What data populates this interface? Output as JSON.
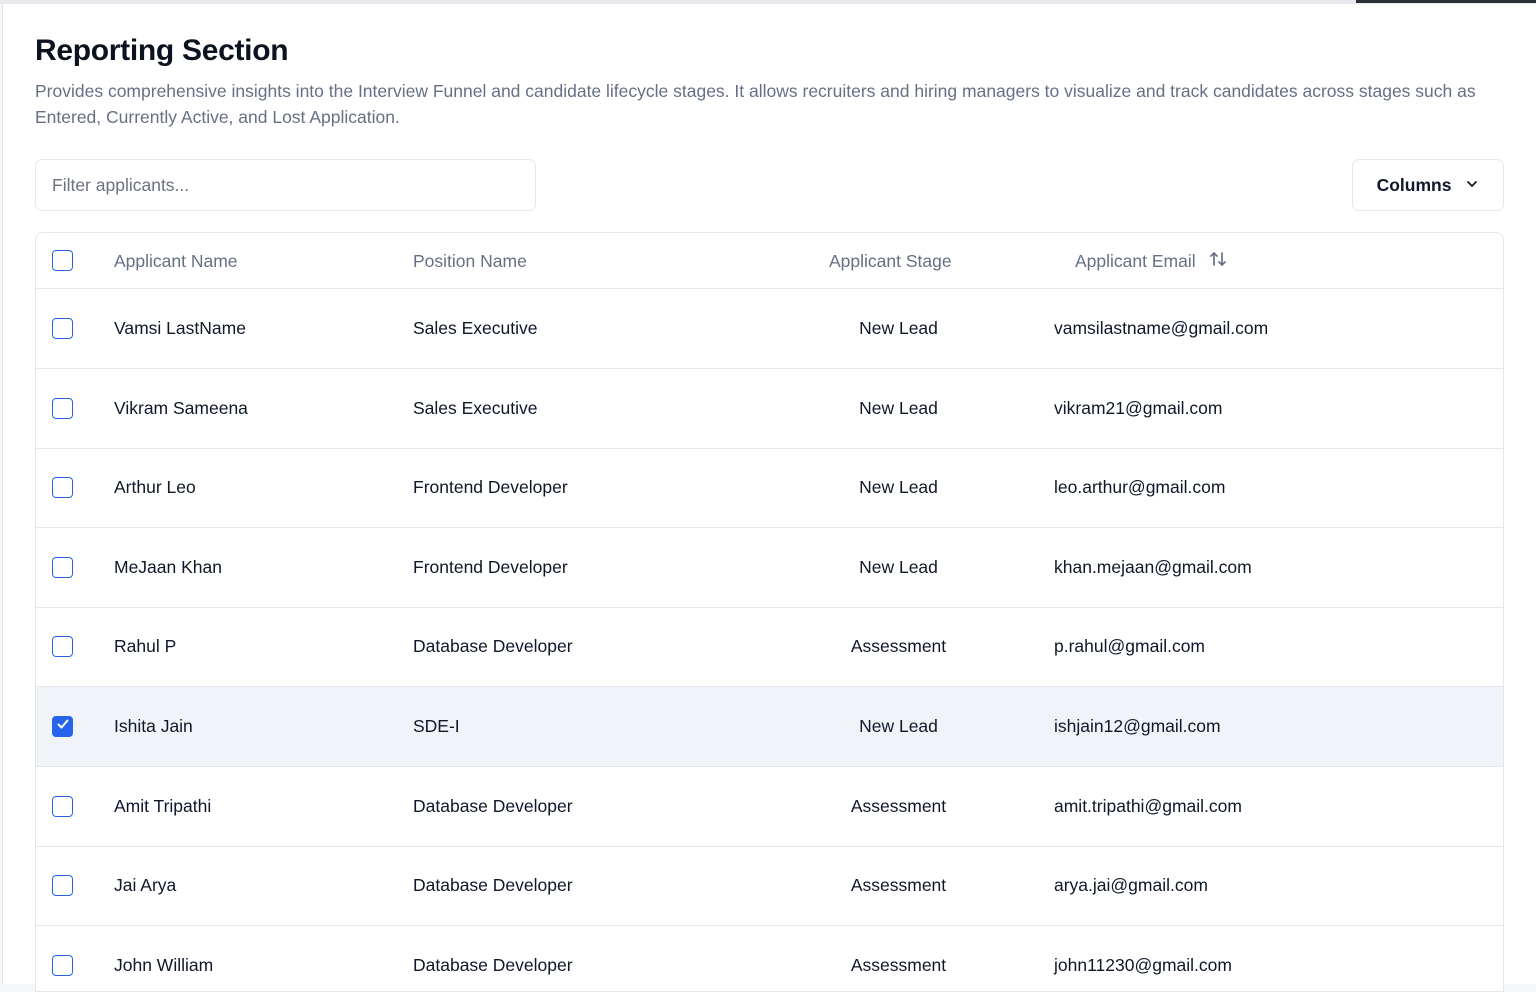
{
  "page": {
    "title": "Reporting Section",
    "description": "Provides comprehensive insights into the Interview Funnel and candidate lifecycle stages. It allows recruiters and hiring managers to visualize and track candidates across stages such as Entered, Currently Active, and Lost Application."
  },
  "toolbar": {
    "filter_placeholder": "Filter applicants...",
    "filter_value": "",
    "columns_label": "Columns"
  },
  "table": {
    "headers": {
      "name": "Applicant Name",
      "position": "Position Name",
      "stage": "Applicant Stage",
      "email": "Applicant Email"
    },
    "rows": [
      {
        "name": "Vamsi LastName",
        "position": "Sales Executive",
        "stage": "New Lead",
        "email": "vamsilastname@gmail.com",
        "checked": false
      },
      {
        "name": "Vikram Sameena",
        "position": "Sales Executive",
        "stage": "New Lead",
        "email": "vikram21@gmail.com",
        "checked": false
      },
      {
        "name": "Arthur Leo",
        "position": "Frontend Developer",
        "stage": "New Lead",
        "email": "leo.arthur@gmail.com",
        "checked": false
      },
      {
        "name": "MeJaan Khan",
        "position": "Frontend Developer",
        "stage": "New Lead",
        "email": "khan.mejaan@gmail.com",
        "checked": false
      },
      {
        "name": "Rahul P",
        "position": "Database Developer",
        "stage": "Assessment",
        "email": "p.rahul@gmail.com",
        "checked": false
      },
      {
        "name": "Ishita Jain",
        "position": "SDE-I",
        "stage": "New Lead",
        "email": "ishjain12@gmail.com",
        "checked": true
      },
      {
        "name": "Amit Tripathi",
        "position": "Database Developer",
        "stage": "Assessment",
        "email": "amit.tripathi@gmail.com",
        "checked": false
      },
      {
        "name": "Jai Arya",
        "position": "Database Developer",
        "stage": "Assessment",
        "email": "arya.jai@gmail.com",
        "checked": false
      },
      {
        "name": "John William",
        "position": "Database Developer",
        "stage": "Assessment",
        "email": "john11230@gmail.com",
        "checked": false
      }
    ]
  },
  "colors": {
    "accent": "#2563eb",
    "muted_text": "#667085",
    "border": "#e3e7ed",
    "selected_row": "#f0f3f8"
  },
  "icons": {
    "columns_button": "chevron-down-icon",
    "email_sort": "sort-arrows-icon",
    "checkbox_checked": "check-icon"
  }
}
